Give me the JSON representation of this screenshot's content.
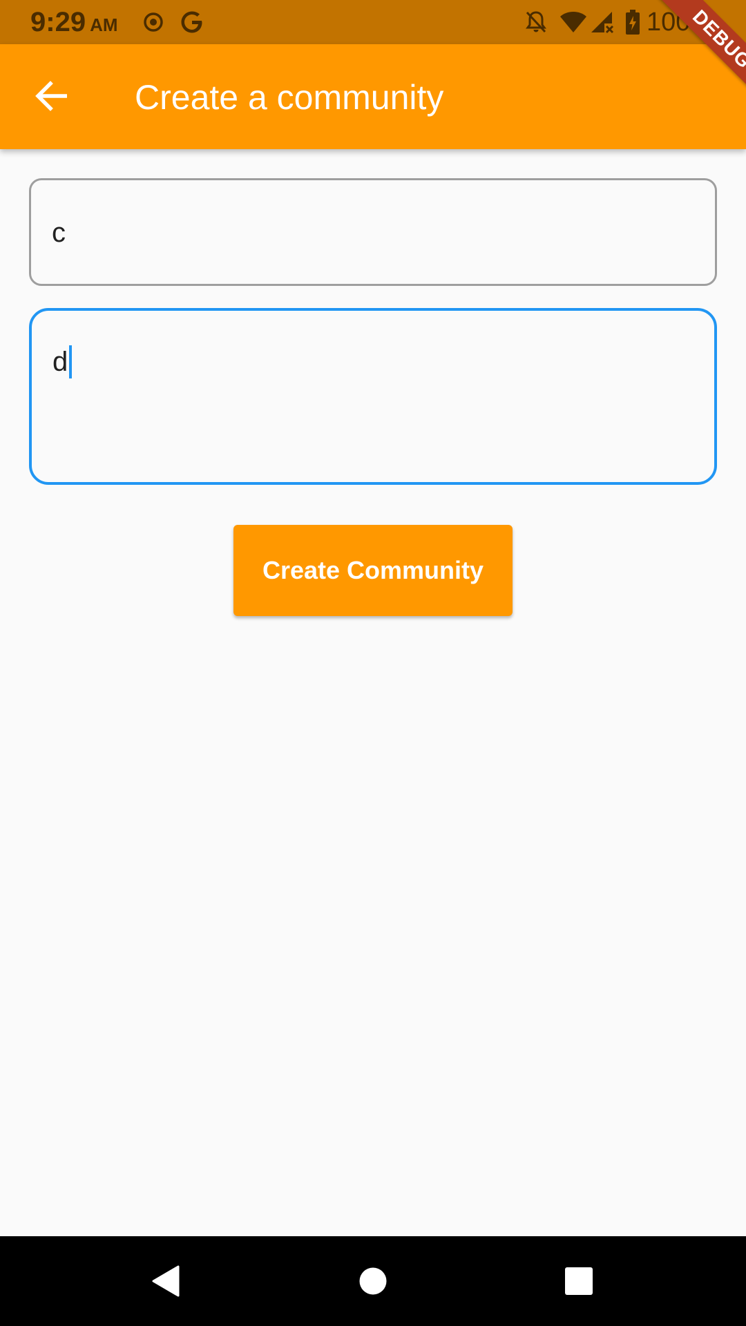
{
  "status_bar": {
    "time": "9:29",
    "ampm": "AM",
    "battery_percent": "100%",
    "icons": [
      "radio-icon",
      "google-icon",
      "notifications-off-icon",
      "wifi-icon",
      "signal-icon",
      "battery-charging-icon"
    ]
  },
  "app_bar": {
    "title": "Create a community",
    "back_icon": "arrow-back-icon",
    "background_color": "#ff9800"
  },
  "debug_banner": {
    "label": "DEBUG"
  },
  "form": {
    "name_value": "c",
    "description_value": "d",
    "submit_label": "Create Community",
    "focused_border_color": "#2196f3"
  },
  "nav_bar": {
    "buttons": [
      "back-triangle-icon",
      "home-circle-icon",
      "recents-square-icon"
    ]
  }
}
